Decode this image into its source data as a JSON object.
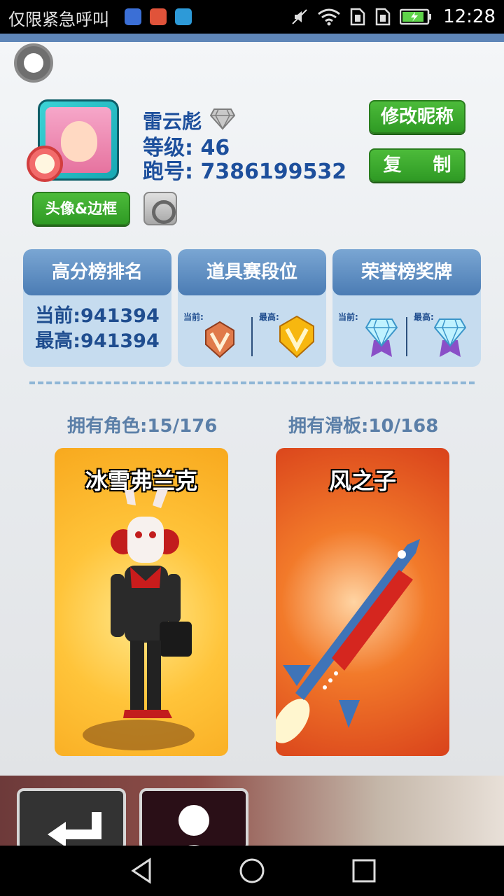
{
  "status_bar": {
    "carrier_text": "仅限紧急呼叫",
    "time": "12:28",
    "app_icon_colors": [
      "#3b6fd6",
      "#e0533a",
      "#2d9ad8"
    ]
  },
  "profile": {
    "name": "雷云彪",
    "level": "等级: 46",
    "runner_id": "跑号: 7386199532",
    "rename_button": "修改昵称",
    "copy_button": "复 制",
    "avatar_frame_button": "头像&边框"
  },
  "stat_cards": {
    "score_rank": {
      "title": "高分榜排名",
      "current": "当前:941394",
      "highest": "最高:941394"
    },
    "item_tier": {
      "title": "道具赛段位",
      "current_label": "当前:",
      "highest_label": "最高:"
    },
    "honor_medal": {
      "title": "荣誉榜奖牌",
      "current_label": "当前:",
      "highest_label": "最高:"
    }
  },
  "collection": {
    "characters_owned": "拥有角色:15/176",
    "boards_owned": "拥有滑板:10/168",
    "character_name": "冰雪弗兰克",
    "board_name": "风之子"
  },
  "colors": {
    "accent_blue": "#1d4f9c",
    "button_green": "#3aa92d"
  }
}
